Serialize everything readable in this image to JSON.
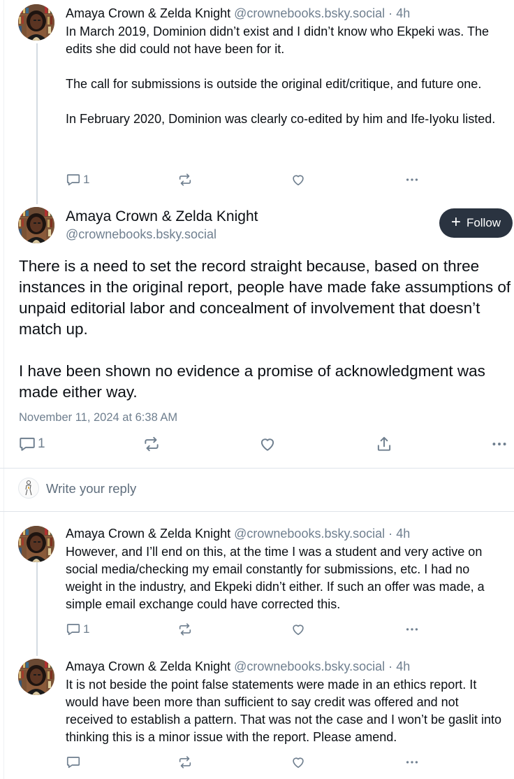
{
  "parent_post": {
    "author_name": "Amaya Crown & Zelda Knight",
    "handle": "@crownebooks.bsky.social",
    "separator": "·",
    "time": "4h",
    "text": "In March 2019, Dominion didn’t exist and I didn’t know who Ekpeki was. The edits she did could not have been for it.\n\nThe call for submissions is outside the original edit/critique, and future one.\n\nIn February 2020, Dominion was clearly co-edited by him and Ife-Iyoku listed.",
    "reply_count": "1"
  },
  "main_post": {
    "author_name": "Amaya Crown & Zelda Knight",
    "handle": "@crownebooks.bsky.social",
    "follow_label": "Follow",
    "text": "There is a need to set the record straight because, based on three instances in the original report, people have made fake assumptions of unpaid editorial labor and concealment of involvement that doesn’t match up.\n\nI have been shown no evidence a promise of acknowledgment was made either way.",
    "date": "November 11, 2024 at 6:38 AM",
    "reply_count": "1"
  },
  "reply_composer": {
    "placeholder": "Write your reply"
  },
  "replies": [
    {
      "author_name": "Amaya Crown & Zelda Knight",
      "handle": "@crownebooks.bsky.social",
      "separator": "·",
      "time": "4h",
      "text": "However, and I’ll end on this, at the time I was a student and very active on social media/checking my email constantly for submissions, etc. I had no weight in the industry, and Ekpeki didn’t either. If such an offer was made, a simple email exchange could have corrected this.",
      "reply_count": "1"
    },
    {
      "author_name": "Amaya Crown & Zelda Knight",
      "handle": "@crownebooks.bsky.social",
      "separator": "·",
      "time": "4h",
      "text": "It is not beside the point false statements were made in an ethics report. It would have been more than sufficient to say credit was offered and not received to establish a pattern. That was not the case and I won’t be gaslit into thinking this is a minor issue with the report. Please amend.",
      "reply_count": ""
    }
  ],
  "icons": {
    "reply": "speech-bubble-icon",
    "repost": "repost-arrows-icon",
    "like": "heart-icon",
    "share": "share-upload-icon",
    "more": "ellipsis-icon",
    "follow": "plus-icon"
  },
  "colors": {
    "text": "#0b0f14",
    "muted": "#6f7f8f",
    "follow_bg": "#2a3340",
    "thread_line": "#d4dbe2"
  }
}
